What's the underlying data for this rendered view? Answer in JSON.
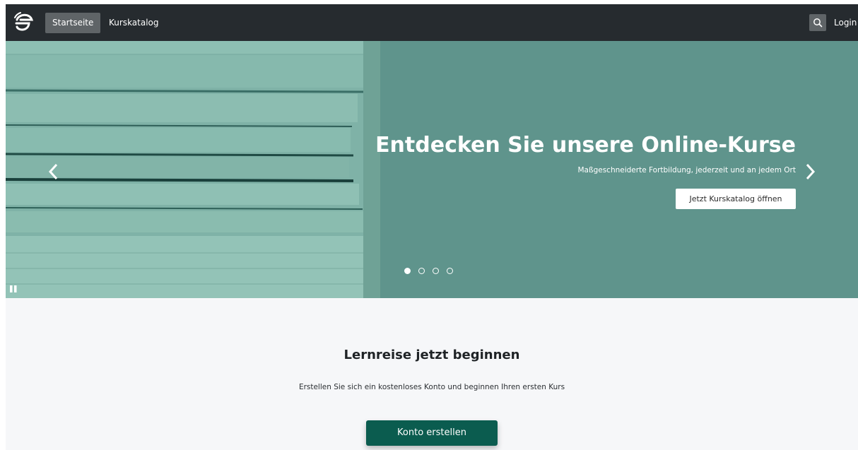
{
  "nav": {
    "items": [
      {
        "label": "Startseite",
        "active": true
      },
      {
        "label": "Kurskatalog",
        "active": false
      }
    ],
    "search_icon": "search-icon",
    "login_label": "Login"
  },
  "hero": {
    "title": "Entdecken Sie unsere Online-Kurse",
    "subtitle": "Maßgeschneiderte Fortbildung, jederzeit und an jedem Ort",
    "cta_label": "Jetzt Kurskatalog öffnen",
    "slide_count": 4,
    "active_slide": 1
  },
  "section": {
    "title": "Lernreise jetzt beginnen",
    "text": "Erstellen Sie sich ein kostenloses Konto und beginnen Ihren ersten Kurs",
    "button_label": "Konto erstellen"
  },
  "colors": {
    "navbar": "#262b2f",
    "hero_overlay": "#5f948c",
    "primary_button": "#0b5c4f",
    "page_background": "#f6f7f9"
  }
}
